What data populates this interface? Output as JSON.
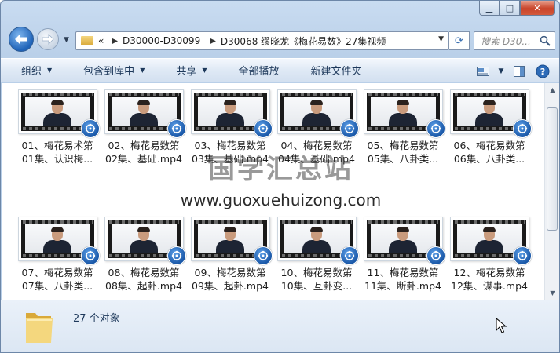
{
  "window": {
    "caption": {
      "minimize": "▁",
      "maximize": "□",
      "close": "✕"
    }
  },
  "nav": {
    "back_icon": "back-arrow-icon",
    "forward_icon": "forward-arrow-icon",
    "history_dropdown": "▼"
  },
  "address": {
    "overflow": "«",
    "segments": [
      "D30000-D30099",
      "D30068 缪晓龙《梅花易数》27集视频"
    ],
    "dropdown": "▼",
    "refresh_icon": "⟳"
  },
  "search": {
    "placeholder": "搜索 D30..."
  },
  "toolbar": {
    "organize": "组织",
    "include_in_library": "包含到库中",
    "share": "共享",
    "play_all": "全部播放",
    "new_folder": "新建文件夹",
    "dropdown_arrow": "▼"
  },
  "files": [
    {
      "line1": "01、梅花易术第",
      "line2": "01集、认识梅..."
    },
    {
      "line1": "02、梅花易数第",
      "line2": "02集、基础.mp4"
    },
    {
      "line1": "03、梅花易数第",
      "line2": "03集、基础.mp4"
    },
    {
      "line1": "04、梅花易数第",
      "line2": "04集、基础.mp4"
    },
    {
      "line1": "05、梅花易数第",
      "line2": "05集、八卦类..."
    },
    {
      "line1": "06、梅花易数第",
      "line2": "06集、八卦类..."
    },
    {
      "line1": "07、梅花易数第",
      "line2": "07集、八卦类..."
    },
    {
      "line1": "08、梅花易数第",
      "line2": "08集、起卦.mp4"
    },
    {
      "line1": "09、梅花易数第",
      "line2": "09集、起卦.mp4"
    },
    {
      "line1": "10、梅花易数第",
      "line2": "10集、互卦变..."
    },
    {
      "line1": "11、梅花易数第",
      "line2": "11集、断卦.mp4"
    },
    {
      "line1": "12、梅花易数第",
      "line2": "12集、谋事.mp4"
    }
  ],
  "watermark": {
    "title": "国学汇总站",
    "url": "www.guoxuehuizong.com"
  },
  "status": {
    "object_count": "27 个对象"
  },
  "scrollbar": {
    "up": "▲",
    "down": "▼"
  },
  "colors": {
    "accent": "#1f63b8",
    "chrome": "#b9cfe8"
  }
}
